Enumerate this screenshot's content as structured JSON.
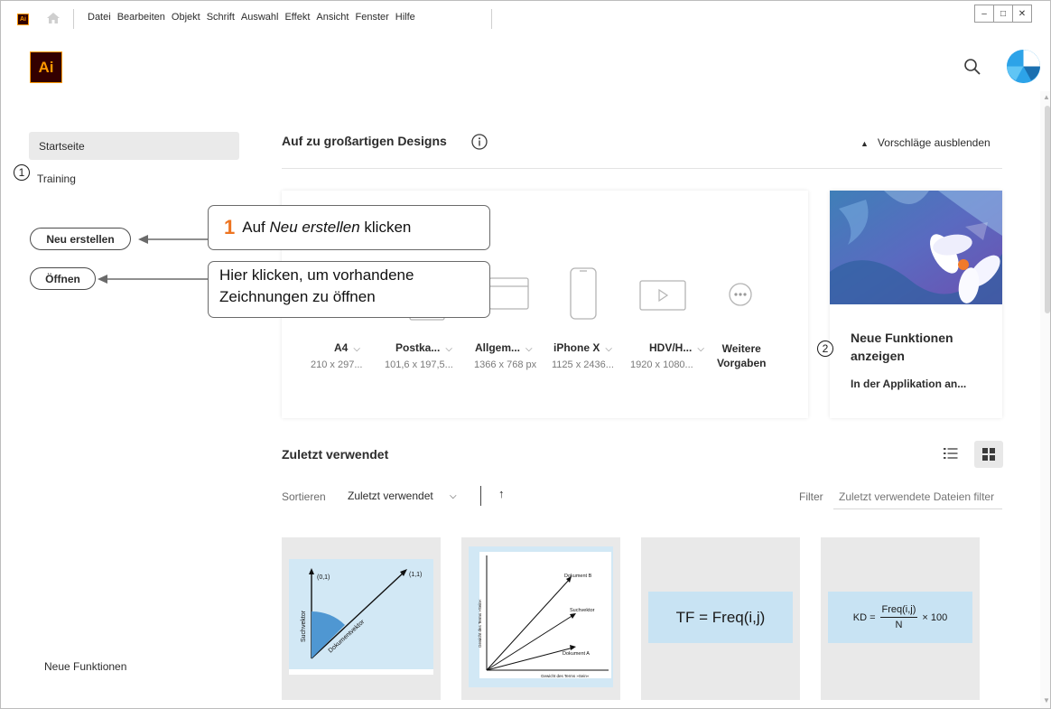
{
  "app": {
    "badge": "Ai",
    "logo": "Ai"
  },
  "menu": {
    "items": [
      "Datei",
      "Bearbeiten",
      "Objekt",
      "Schrift",
      "Auswahl",
      "Effekt",
      "Ansicht",
      "Fenster",
      "Hilfe"
    ]
  },
  "window_controls": {
    "minimize": "–",
    "maximize": "□",
    "close": "✕"
  },
  "sidebar": {
    "home": "Startseite",
    "training": "Training",
    "new_button": "Neu erstellen",
    "open_button": "Öffnen",
    "whats_new": "Neue Funktionen"
  },
  "markers": {
    "m1": "①",
    "m2": "②"
  },
  "callouts": {
    "one_number": "1",
    "one_prefix": "Auf ",
    "one_italic": "Neu erstellen",
    "one_suffix": " klicken",
    "two_line1": "Hier klicken, um vorhandene",
    "two_line2": "Zeichnungen zu öffnen"
  },
  "hero": {
    "title": "Auf zu großartigen Designs",
    "hide_suggestions": "Vorschläge ausblenden"
  },
  "presets": [
    {
      "name": "A4",
      "size": "210 x 297...",
      "icon": "document-icon"
    },
    {
      "name": "Postka...",
      "size": "101,6 x 197,5...",
      "icon": "postcard-icon"
    },
    {
      "name": "Allgem...",
      "size": "1366 x 768 px",
      "icon": "monitor-icon"
    },
    {
      "name": "iPhone X",
      "size": "1125 x 2436...",
      "icon": "phone-icon"
    },
    {
      "name": "HDV/H...",
      "size": "1920 x 1080...",
      "icon": "video-icon"
    },
    {
      "name": "Weitere Vorgaben",
      "name_line1": "Weitere",
      "name_line2": "Vorgaben",
      "icon": "more-icon"
    }
  ],
  "feature": {
    "title": "Neue Funktionen anzeigen",
    "title_line1": "Neue Funktionen",
    "title_line2": "anzeigen",
    "subtitle": "In der Applikation an..."
  },
  "recent": {
    "title": "Zuletzt verwendet",
    "sort_label": "Sortieren",
    "sort_value": "Zuletzt verwendet",
    "sort_caret": "⌵",
    "sort_direction": "↑",
    "filter_label": "Filter",
    "filter_placeholder": "Zuletzt verwendete Dateien filter"
  },
  "thumbnails": {
    "t1": {
      "point_origin": "(0,1)",
      "point_end": "(1,1)",
      "axis_y": "Suchvektor",
      "diag": "Dokumentvektor"
    },
    "t2": {
      "doc_b": "Dokument B",
      "search": "Suchvektor",
      "doc_a": "Dokument A",
      "y_axis": "Gewicht des Terms »Sein«",
      "x_axis": "Gewicht des Terms »Sein«"
    },
    "t3": {
      "formula": "TF = Freq(i,j)"
    },
    "t4": {
      "prefix": "KD =",
      "numerator": "Freq(i,j)",
      "denominator": "N",
      "suffix": "× 100"
    }
  },
  "colors": {
    "accent_orange": "#ed7421",
    "ai_brand_orange": "#ff9a00",
    "thumb_blue": "#d2e8f5",
    "avatar_blue": "#2da3e8"
  }
}
